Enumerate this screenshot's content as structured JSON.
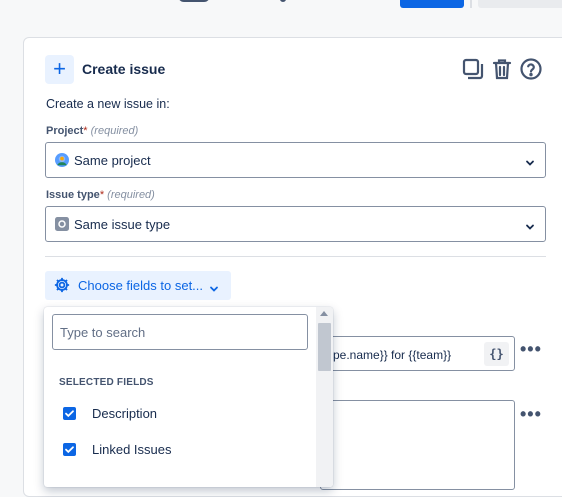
{
  "header": {
    "title": "Create issue",
    "actions": [
      {
        "name": "duplicate-icon"
      },
      {
        "name": "trash-icon"
      },
      {
        "name": "help-icon"
      }
    ]
  },
  "form": {
    "subtitle": "Create a new issue in:",
    "project": {
      "label": "Project",
      "required_mark": "*",
      "hint": "(required)",
      "value": "Same project",
      "icon": "project-avatar-icon"
    },
    "issue_type": {
      "label": "Issue type",
      "required_mark": "*",
      "hint": "(required)",
      "value": "Same issue type",
      "icon": "issue-type-icon"
    },
    "choose_fields": {
      "label": "Choose fields to set...",
      "icon": "gear-icon"
    },
    "summary_field": {
      "value": "pe.name}} for {{team}}",
      "smart_value_button": "{}"
    }
  },
  "dropdown": {
    "search_placeholder": "Type to search",
    "section_label": "SELECTED FIELDS",
    "options": [
      {
        "label": "Description",
        "checked": true
      },
      {
        "label": "Linked Issues",
        "checked": true
      }
    ]
  },
  "colors": {
    "accent": "#0c66e4",
    "accent_bg": "#e9f2ff",
    "text": "#172b4d",
    "subtle_text": "#44546f",
    "border": "#8590a2",
    "required": "#ae2a19"
  }
}
